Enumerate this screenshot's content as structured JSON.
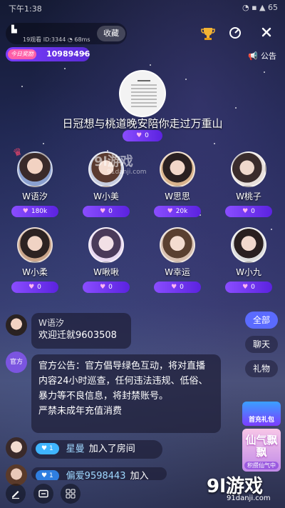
{
  "status_bar": {
    "time": "下午1:38",
    "right": "◔ ▪ ▲ 65"
  },
  "room": {
    "flag": "▙",
    "sub_info": "19观看 ID:3344 ◔ 68ms",
    "favorite_label": "收藏",
    "today_tag": "今日奖励",
    "today_value": "10989496",
    "today_chevron": "›",
    "notice_label": "公告"
  },
  "host": {
    "title": "日冠想与桃道晚安陪你走过万重山",
    "hearts": "0"
  },
  "seats": [
    {
      "name": "W语汐",
      "hearts": "180k"
    },
    {
      "name": "W小美",
      "hearts": "0"
    },
    {
      "name": "W思思",
      "hearts": "20k"
    },
    {
      "name": "W桃子",
      "hearts": "0"
    },
    {
      "name": "W小柔",
      "hearts": "0"
    },
    {
      "name": "W啾啾",
      "hearts": "0"
    },
    {
      "name": "W幸运",
      "hearts": "0"
    },
    {
      "name": "W小九",
      "hearts": "0"
    }
  ],
  "chat": {
    "msg1_name": "W语汐",
    "msg1_text": "欢迎迁就9603508",
    "announce_badge": "官方",
    "announce_text": "官方公告：官方倡导绿色互动，将对直播内容24小时巡查，任何违法违规、低俗、暴力等不良信息，将封禁账号。",
    "announce_text2": "严禁未成年充值消费",
    "join_level": "1",
    "join_name": "星曼",
    "join_text": "加入了房间",
    "join2_name": "偏爱9598443",
    "join2_text": "加入",
    "join2_level": "1"
  },
  "filters": {
    "all": "全部",
    "chat": "聊天",
    "gift": "礼物"
  },
  "promos": {
    "first_charge": "首充礼包",
    "event_title": "仙气飘飘",
    "event_sub": "积攒仙气中"
  },
  "watermark": {
    "logo": "9l游戏",
    "site": "91danji.com",
    "mid_logo": "9l游戏",
    "mid_site": "91danji.com"
  },
  "colors": {
    "accent": "#7b3dff",
    "pill": "#5b22e0",
    "active_filter": "#5b6bff"
  }
}
